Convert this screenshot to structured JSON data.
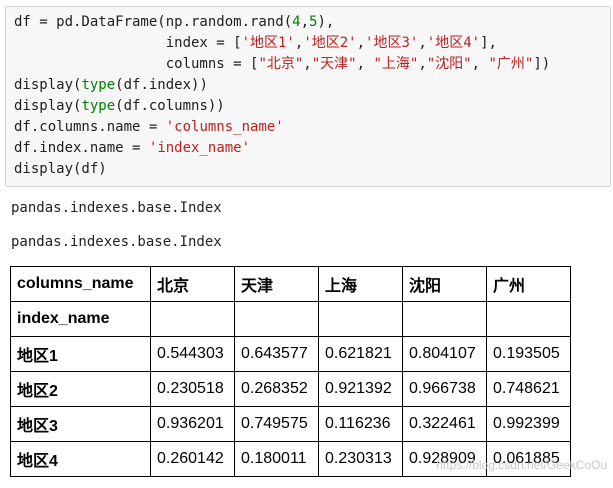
{
  "code_cell": {
    "lines": [
      [
        {
          "t": "df = pd.DataFrame(np.random.rand(",
          "c": "plain"
        },
        {
          "t": "4",
          "c": "num"
        },
        {
          "t": ",",
          "c": "plain"
        },
        {
          "t": "5",
          "c": "num"
        },
        {
          "t": "),",
          "c": "plain"
        }
      ],
      [
        {
          "t": "                  index = [",
          "c": "plain"
        },
        {
          "t": "'地区1'",
          "c": "str"
        },
        {
          "t": ",",
          "c": "plain"
        },
        {
          "t": "'地区2'",
          "c": "str"
        },
        {
          "t": ",",
          "c": "plain"
        },
        {
          "t": "'地区3'",
          "c": "str"
        },
        {
          "t": ",",
          "c": "plain"
        },
        {
          "t": "'地区4'",
          "c": "str"
        },
        {
          "t": "],",
          "c": "plain"
        }
      ],
      [
        {
          "t": "                  columns = [",
          "c": "plain"
        },
        {
          "t": "\"北京\"",
          "c": "str"
        },
        {
          "t": ",",
          "c": "plain"
        },
        {
          "t": "\"天津\"",
          "c": "str"
        },
        {
          "t": ", ",
          "c": "plain"
        },
        {
          "t": "\"上海\"",
          "c": "str"
        },
        {
          "t": ",",
          "c": "plain"
        },
        {
          "t": "\"沈阳\"",
          "c": "str"
        },
        {
          "t": ", ",
          "c": "plain"
        },
        {
          "t": "\"广州\"",
          "c": "str"
        },
        {
          "t": "])",
          "c": "plain"
        }
      ],
      [
        {
          "t": "display(",
          "c": "plain"
        },
        {
          "t": "type",
          "c": "builtin"
        },
        {
          "t": "(df.index))",
          "c": "plain"
        }
      ],
      [
        {
          "t": "display(",
          "c": "plain"
        },
        {
          "t": "type",
          "c": "builtin"
        },
        {
          "t": "(df.columns))",
          "c": "plain"
        }
      ],
      [
        {
          "t": "df.columns.name ",
          "c": "plain"
        },
        {
          "t": "=",
          "c": "plain"
        },
        {
          "t": " ",
          "c": "plain"
        },
        {
          "t": "'columns_name'",
          "c": "str"
        }
      ],
      [
        {
          "t": "df.index.name ",
          "c": "plain"
        },
        {
          "t": "=",
          "c": "plain"
        },
        {
          "t": " ",
          "c": "plain"
        },
        {
          "t": "'index_name'",
          "c": "str"
        }
      ],
      [
        {
          "t": "display(df)",
          "c": "plain"
        }
      ]
    ]
  },
  "outputs": {
    "type_index": "pandas.indexes.base.Index",
    "type_columns": "pandas.indexes.base.Index"
  },
  "table": {
    "columns_name": "columns_name",
    "index_name": "index_name",
    "columns": [
      "北京",
      "天津",
      "上海",
      "沈阳",
      "广州"
    ],
    "rows": [
      {
        "label": "地区1",
        "values": [
          "0.544303",
          "0.643577",
          "0.621821",
          "0.804107",
          "0.193505"
        ]
      },
      {
        "label": "地区2",
        "values": [
          "0.230518",
          "0.268352",
          "0.921392",
          "0.966738",
          "0.748621"
        ]
      },
      {
        "label": "地区3",
        "values": [
          "0.936201",
          "0.749575",
          "0.116236",
          "0.322461",
          "0.992399"
        ]
      },
      {
        "label": "地区4",
        "values": [
          "0.260142",
          "0.180011",
          "0.230313",
          "0.928909",
          "0.061885"
        ]
      }
    ]
  },
  "watermark": "https://blog.csdn.net/GeekCoOu"
}
